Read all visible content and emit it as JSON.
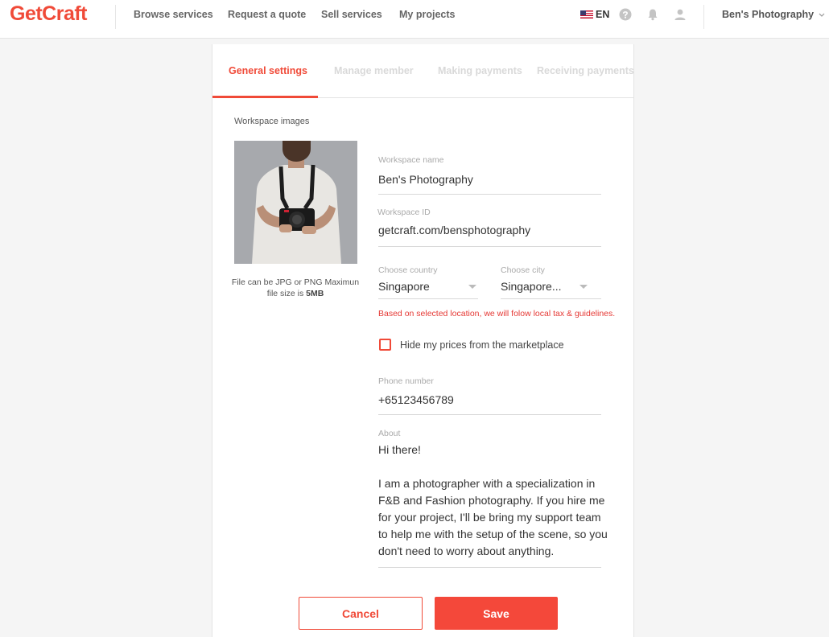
{
  "brand": {
    "name": "GetCraft",
    "accent": "#f04a38"
  },
  "nav": {
    "links": [
      "Browse services",
      "Request a quote",
      "Sell services",
      "My projects"
    ],
    "language": "EN",
    "user": "Ben's Photography",
    "icons": [
      "us-flag-icon",
      "help-icon",
      "bell-icon",
      "user-icon",
      "chevron-down-icon"
    ]
  },
  "tabs": {
    "items": [
      "General settings",
      "Manage member",
      "Making payments",
      "Receiving payments"
    ],
    "active": "General settings"
  },
  "workspace_images": {
    "label": "Workspace images",
    "note_prefix": "File can be JPG or PNG Maximun file size is ",
    "note_bold": "5MB"
  },
  "form": {
    "workspace_name": {
      "label": "Workspace name",
      "value": "Ben's Photography"
    },
    "workspace_id": {
      "label": "Workspace ID",
      "prefix": "getcraft.com/",
      "value": "bensphotography"
    },
    "country": {
      "label": "Choose country",
      "value": "Singapore"
    },
    "city": {
      "label": "Choose city",
      "value": "Singapore..."
    },
    "location_hint": "Based on selected location, we will folow local tax & guidelines.",
    "hide_prices": {
      "label": "Hide my prices from the marketplace",
      "checked": false
    },
    "phone": {
      "label": "Phone number",
      "value": "+65123456789"
    },
    "about": {
      "label": "About",
      "value": "Hi there!\n\nI am a photographer with a specialization in F&B and Fashion photography. If you hire me for your project, I'll be bring my support team to help me with the setup of the scene, so you don't need to worry about anything."
    }
  },
  "actions": {
    "cancel": "Cancel",
    "save": "Save"
  }
}
